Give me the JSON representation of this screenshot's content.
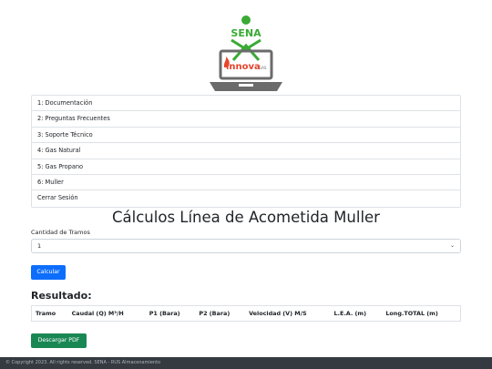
{
  "logo": {
    "brand_text": "SENA",
    "product_text": "innova",
    "product_suffix": "GAS",
    "colors": {
      "green": "#3aaa35",
      "laptop": "#6b6b6b",
      "flame": "#e8452c"
    }
  },
  "menu": {
    "items": [
      {
        "label": "1: Documentación"
      },
      {
        "label": "2: Preguntas Frecuentes"
      },
      {
        "label": "3: Soporte Técnico"
      },
      {
        "label": "4: Gas Natural"
      },
      {
        "label": "5: Gas Propano"
      },
      {
        "label": "6: Muller"
      },
      {
        "label": "Cerrar Sesión"
      }
    ]
  },
  "main": {
    "title": "Cálculos Línea de Acometida Muller",
    "tramos_label": "Cantidad de Tramos",
    "tramos_value": "1",
    "calc_button": "Calcular",
    "result_title": "Resultado:",
    "table_headers": [
      "Tramo",
      "Caudal (Q) M³/H",
      "P1 (Bara)",
      "P2 (Bara)",
      "Velocidad (V) M/S",
      "L.E.A. (m)",
      "Long.TOTAL (m)"
    ],
    "pdf_button": "Descargar PDF"
  },
  "footer": {
    "text": "© Copyright 2023. All rights reserved. SENA - RUS Almacenamiento"
  },
  "colors": {
    "primary": "#0d6efd",
    "success": "#198754",
    "footer_bg": "#343a40"
  }
}
